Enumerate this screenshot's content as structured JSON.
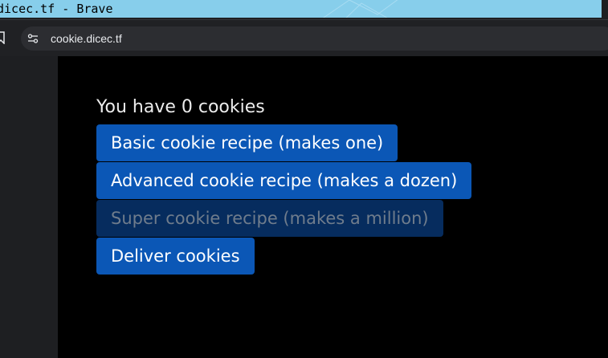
{
  "window": {
    "title": "dicec.tf - Brave"
  },
  "browser": {
    "url": "cookie.dicec.tf"
  },
  "page": {
    "cookie_status": "You have 0 cookies",
    "buttons": [
      {
        "label": "Basic cookie recipe (makes one)",
        "enabled": true
      },
      {
        "label": "Advanced cookie recipe (makes a dozen)",
        "enabled": true
      },
      {
        "label": "Super cookie recipe (makes a million)",
        "enabled": false
      },
      {
        "label": "Deliver cookies",
        "enabled": true
      }
    ]
  },
  "colors": {
    "titlebar": "#87ceeb",
    "button": "#0b57b6",
    "button_disabled": "#062c5e",
    "page_background": "#000000"
  }
}
